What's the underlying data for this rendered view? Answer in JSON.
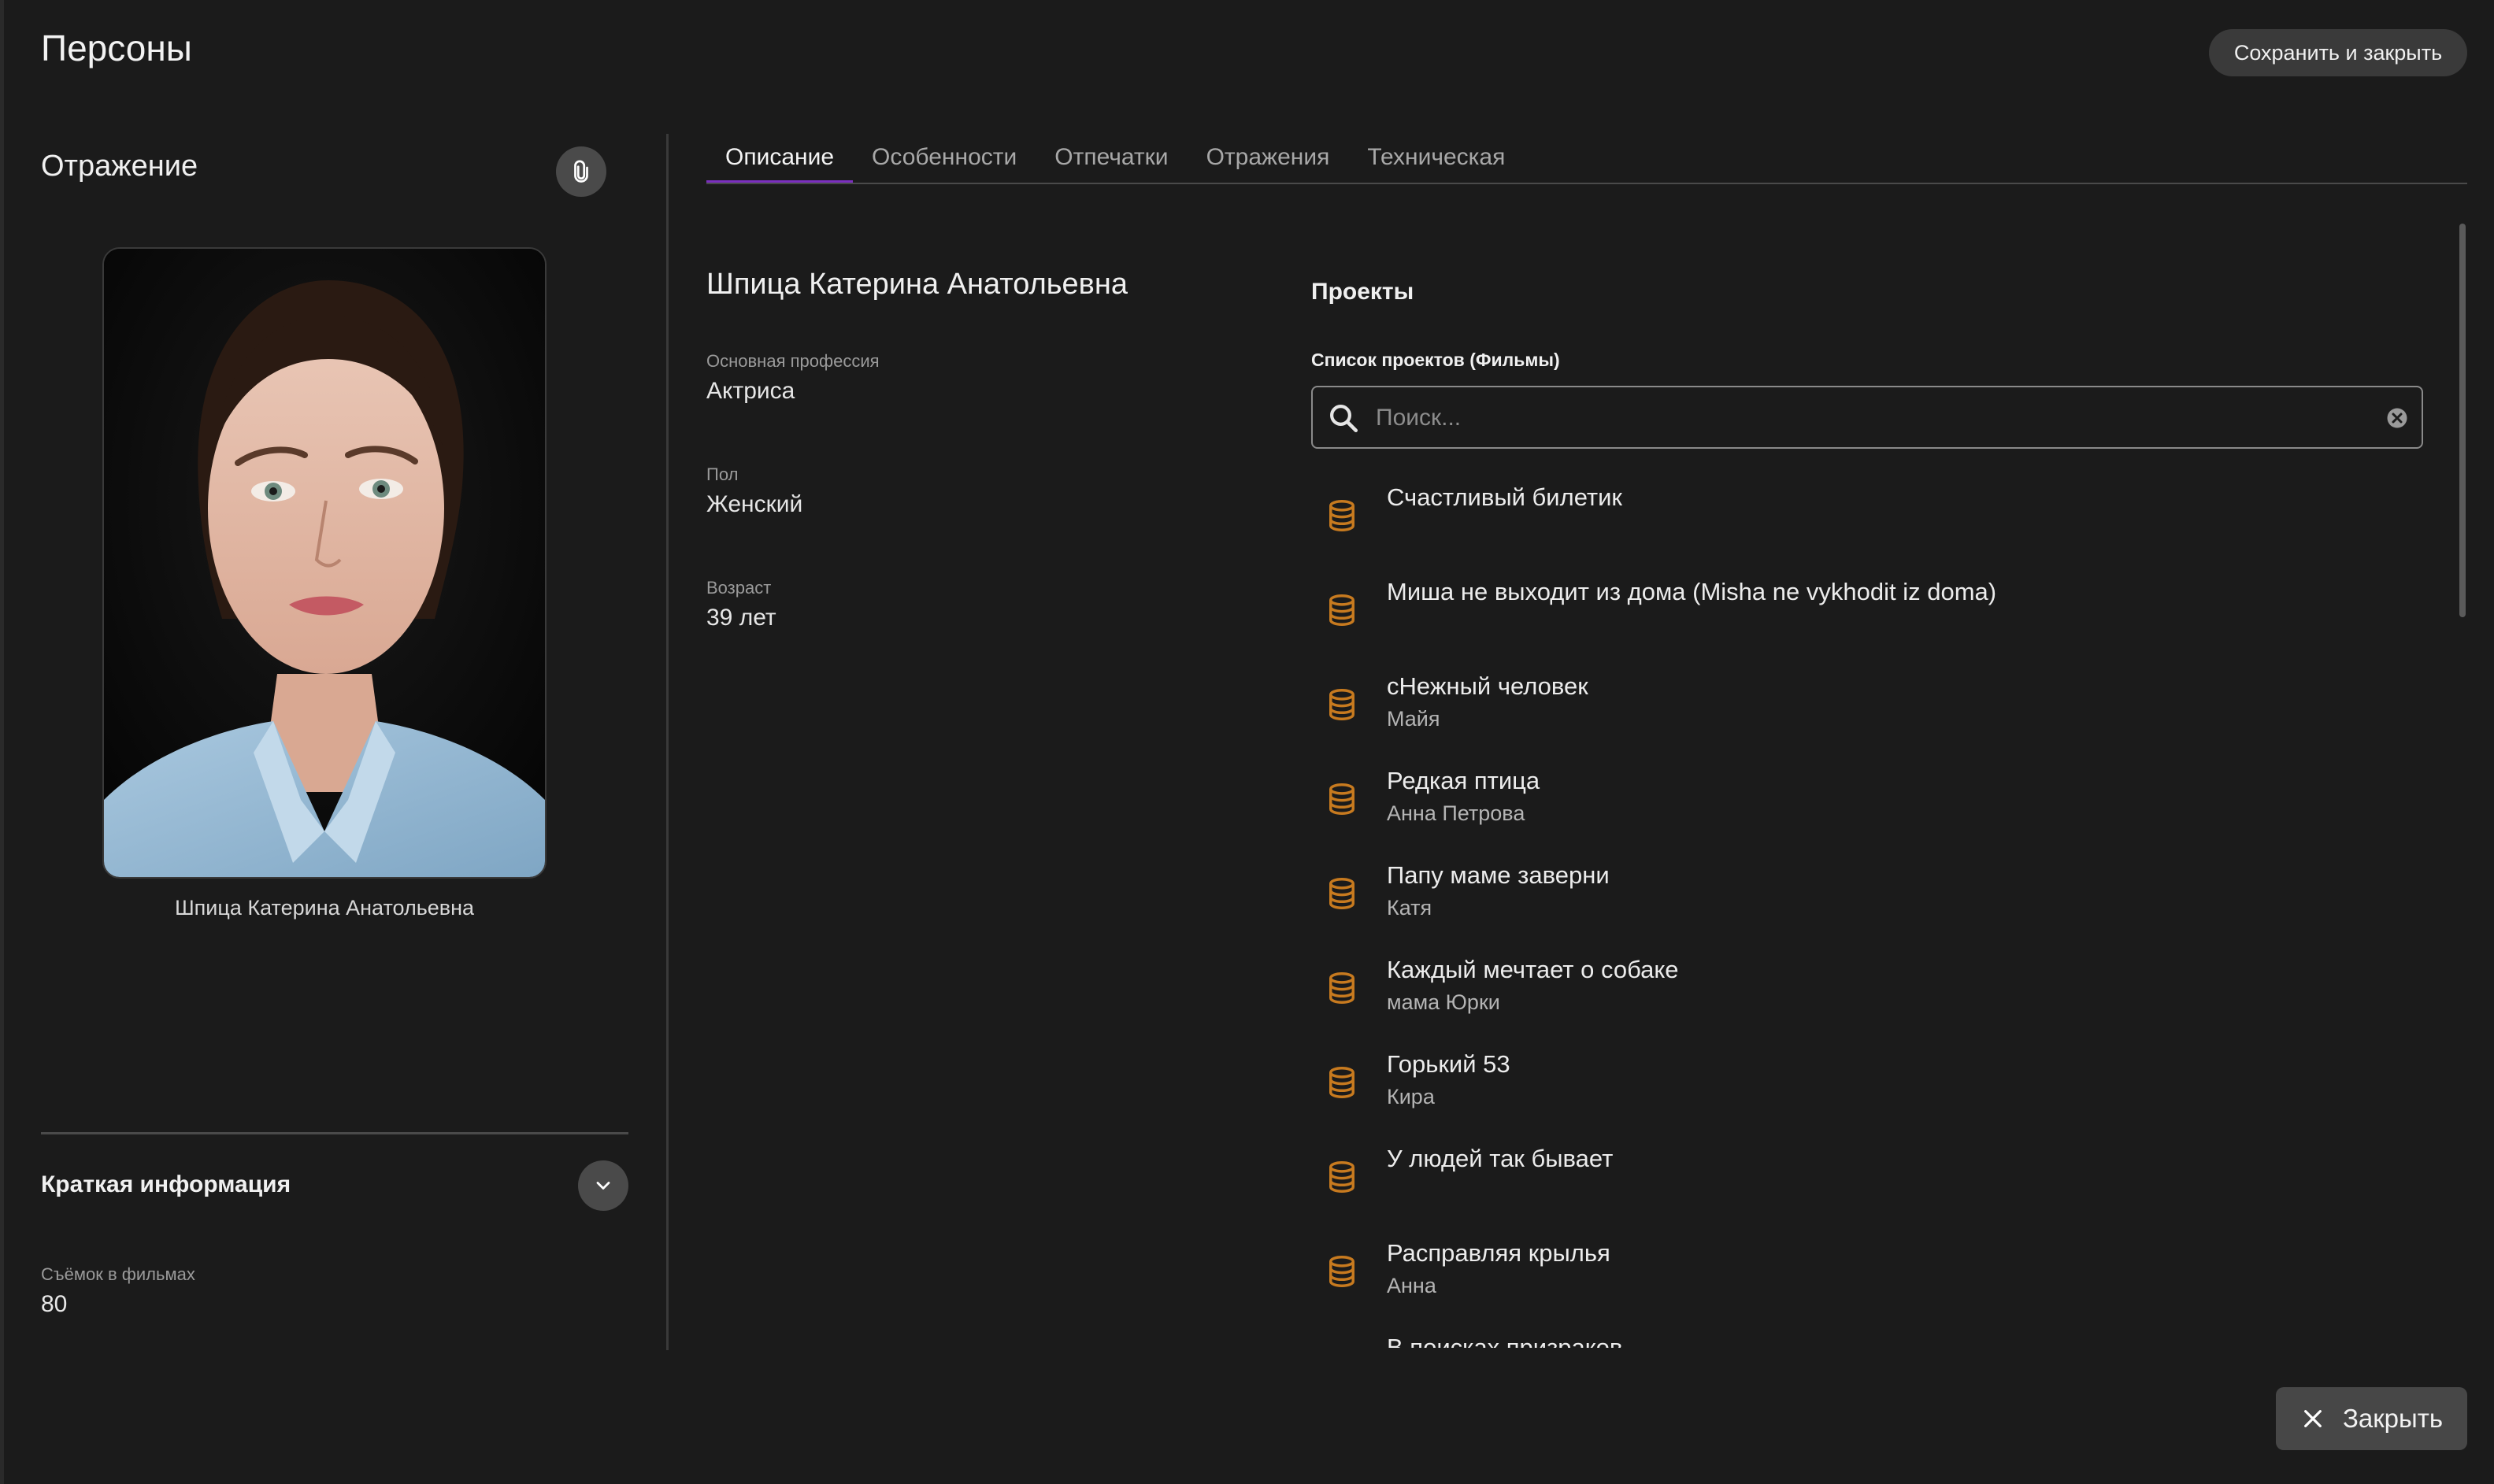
{
  "header": {
    "title": "Персоны",
    "save_close_label": "Сохранить и закрыть"
  },
  "left_panel": {
    "heading": "Отражение",
    "photo_caption": "Шпица Катерина Анатольевна",
    "info_heading": "Краткая информация",
    "films_label": "Съёмок в фильмах",
    "films_value": "80"
  },
  "tabs": [
    {
      "label": "Описание",
      "active": true
    },
    {
      "label": "Особенности",
      "active": false
    },
    {
      "label": "Отпечатки",
      "active": false
    },
    {
      "label": "Отражения",
      "active": false
    },
    {
      "label": "Техническая",
      "active": false
    }
  ],
  "description": {
    "name": "Шпица Катерина Анатольевна",
    "fields": [
      {
        "label": "Основная профессия",
        "value": "Актриса"
      },
      {
        "label": "Пол",
        "value": "Женский"
      },
      {
        "label": "Возраст",
        "value": "39 лет"
      }
    ]
  },
  "projects": {
    "title": "Проекты",
    "list_label": "Список проектов (Фильмы)",
    "search_placeholder": "Поиск...",
    "items": [
      {
        "title": "Счастливый билетик",
        "role": ""
      },
      {
        "title": "Миша не выходит из дома (Misha ne vykhodit iz doma)",
        "role": ""
      },
      {
        "title": "сНежный человек",
        "role": "Майя"
      },
      {
        "title": "Редкая птица",
        "role": "Анна Петрова"
      },
      {
        "title": "Папу маме заверни",
        "role": "Катя"
      },
      {
        "title": "Каждый мечтает о собаке",
        "role": "мама Юрки"
      },
      {
        "title": "Горький 53",
        "role": "Кира"
      },
      {
        "title": "У людей так бывает",
        "role": ""
      },
      {
        "title": "Расправляя крылья",
        "role": "Анна"
      },
      {
        "title": "В поисках призраков",
        "role": ""
      }
    ]
  },
  "footer": {
    "close_label": "Закрыть"
  },
  "colors": {
    "background": "#1b1b1b",
    "accent_tab": "#7b2fbf",
    "db_icon": "#c77a1f"
  },
  "icons": {
    "attach": "paperclip-icon",
    "expand": "chevron-down-icon",
    "search": "search-icon",
    "clear": "clear-icon",
    "project": "database-icon",
    "close": "close-icon"
  }
}
